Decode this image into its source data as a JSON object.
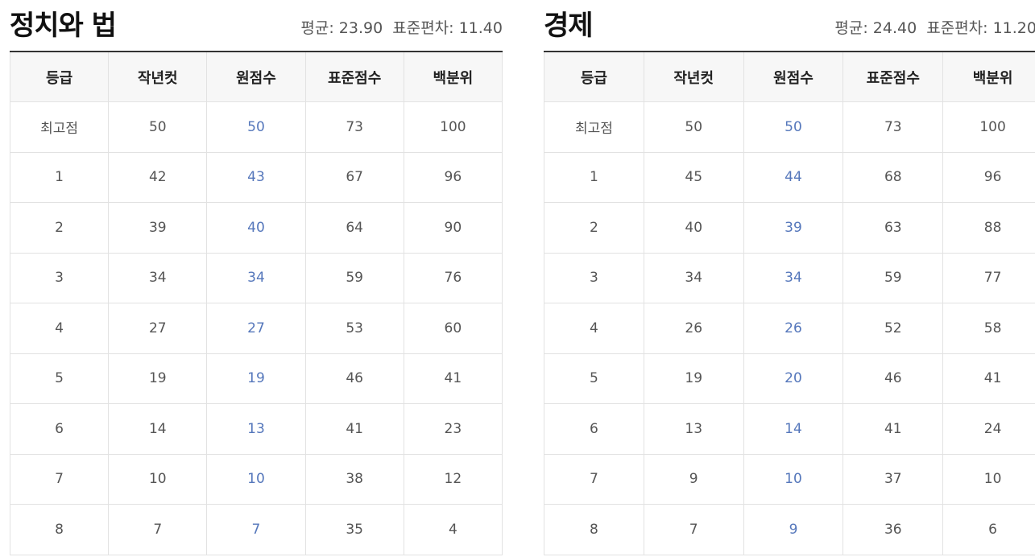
{
  "panels": [
    {
      "title": "정치와 법",
      "mean_label": "평균: 23.90",
      "sd_label": "표준편차: 11.40",
      "headers": [
        "등급",
        "작년컷",
        "원점수",
        "표준점수",
        "백분위"
      ],
      "rows": [
        [
          "최고점",
          "50",
          "50",
          "73",
          "100"
        ],
        [
          "1",
          "42",
          "43",
          "67",
          "96"
        ],
        [
          "2",
          "39",
          "40",
          "64",
          "90"
        ],
        [
          "3",
          "34",
          "34",
          "59",
          "76"
        ],
        [
          "4",
          "27",
          "27",
          "53",
          "60"
        ],
        [
          "5",
          "19",
          "19",
          "46",
          "41"
        ],
        [
          "6",
          "14",
          "13",
          "41",
          "23"
        ],
        [
          "7",
          "10",
          "10",
          "38",
          "12"
        ],
        [
          "8",
          "7",
          "7",
          "35",
          "4"
        ]
      ]
    },
    {
      "title": "경제",
      "mean_label": "평균: 24.40",
      "sd_label": "표준편차: 11.20",
      "headers": [
        "등급",
        "작년컷",
        "원점수",
        "표준점수",
        "백분위"
      ],
      "rows": [
        [
          "최고점",
          "50",
          "50",
          "73",
          "100"
        ],
        [
          "1",
          "45",
          "44",
          "68",
          "96"
        ],
        [
          "2",
          "40",
          "39",
          "63",
          "88"
        ],
        [
          "3",
          "34",
          "34",
          "59",
          "77"
        ],
        [
          "4",
          "26",
          "26",
          "52",
          "58"
        ],
        [
          "5",
          "19",
          "20",
          "46",
          "41"
        ],
        [
          "6",
          "13",
          "14",
          "41",
          "24"
        ],
        [
          "7",
          "9",
          "10",
          "37",
          "10"
        ],
        [
          "8",
          "7",
          "9",
          "36",
          "6"
        ]
      ]
    }
  ],
  "colors": {
    "raw_score": "#5577bb",
    "header_bg": "#f7f7f7",
    "rule": "#333333"
  }
}
